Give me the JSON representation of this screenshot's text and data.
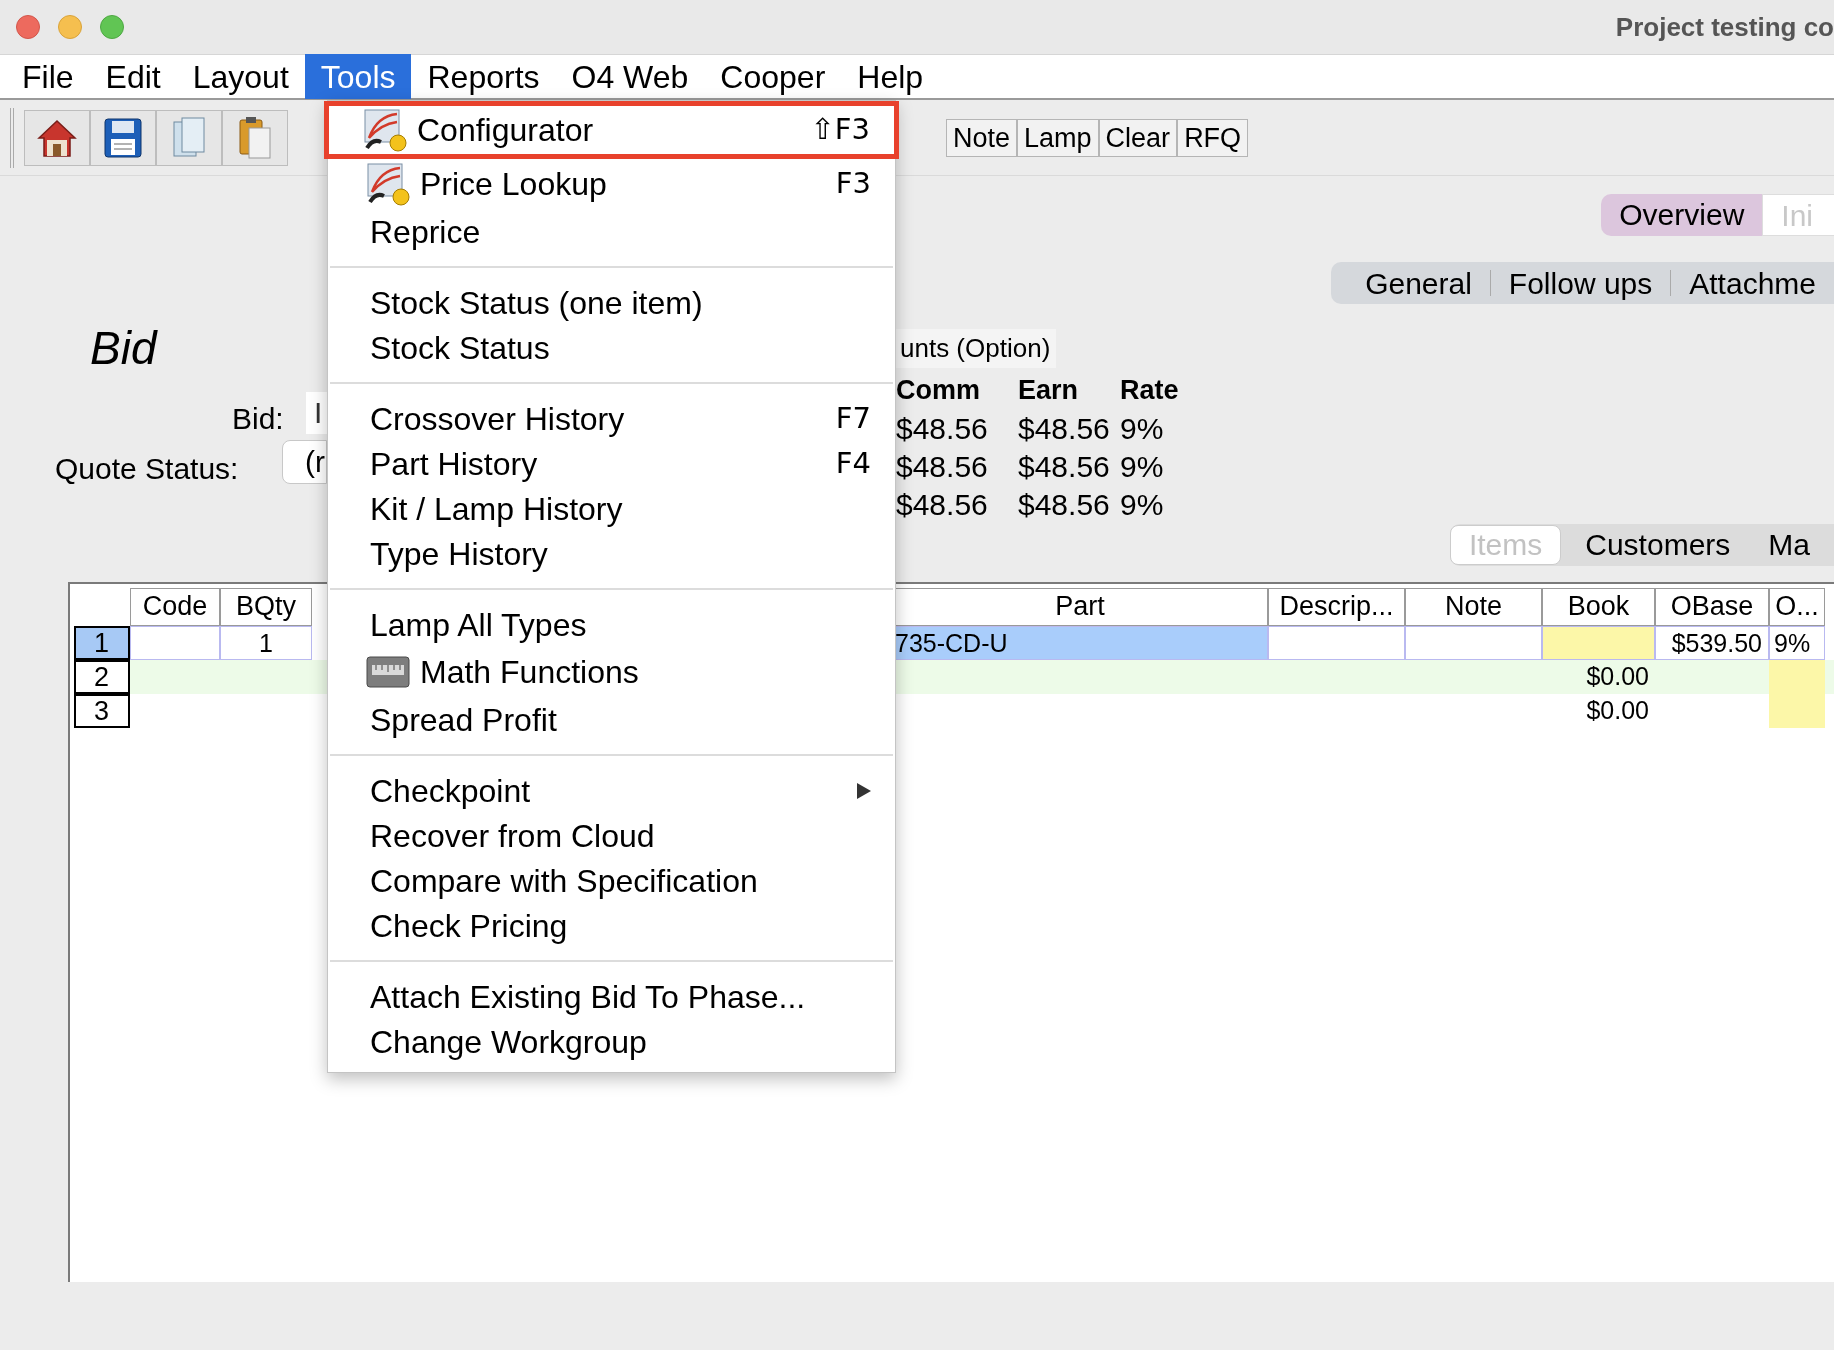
{
  "window": {
    "title": "Project testing co"
  },
  "menu_bar": [
    {
      "label": "File",
      "selected": false
    },
    {
      "label": "Edit",
      "selected": false
    },
    {
      "label": "Layout",
      "selected": false
    },
    {
      "label": "Tools",
      "selected": true
    },
    {
      "label": "Reports",
      "selected": false
    },
    {
      "label": "O4 Web",
      "selected": false
    },
    {
      "label": "Cooper",
      "selected": false
    },
    {
      "label": "Help",
      "selected": false
    }
  ],
  "toolbar": {
    "buttons": [
      "Note",
      "Lamp",
      "Clear",
      "RFQ"
    ]
  },
  "top_tabs": [
    {
      "label": "Overview",
      "selected": true
    },
    {
      "label": "Ini",
      "selected": false
    }
  ],
  "section_tabs": [
    "General",
    "Follow ups",
    "Attachme"
  ],
  "bid": {
    "heading": "Bid",
    "bid_label": "Bid:",
    "bid_value": "I",
    "quote_status_label": "Quote Status:",
    "quote_status_value": "(r"
  },
  "pricing": {
    "caption": "unts (Option)",
    "columns": [
      "Comm",
      "Earn",
      "Rate"
    ],
    "rows": [
      [
        "$48.56",
        "$48.56",
        "9%"
      ],
      [
        "$48.56",
        "$48.56",
        "9%"
      ],
      [
        "$48.56",
        "$48.56",
        "9%"
      ]
    ]
  },
  "items_tabs": [
    {
      "label": "Items",
      "selected": true
    },
    {
      "label": "Customers",
      "selected": false
    },
    {
      "label": "Ma",
      "selected": false
    }
  ],
  "table": {
    "columns": [
      "Code",
      "BQty",
      "Part",
      "Descrip...",
      "Note",
      "Book",
      "OBase",
      "O..."
    ],
    "rows": [
      {
        "number": "1",
        "selected": true,
        "color": "#ffffff",
        "cells": [
          {},
          {
            "text": "1"
          },
          {
            "text": "735-CD-U",
            "color": "#a9cdfb"
          },
          {},
          {},
          {
            "color": "#fcf7a8"
          },
          {
            "text": "$539.50"
          },
          {
            "text": "9%"
          }
        ]
      },
      {
        "number": "2",
        "selected": false,
        "color": "#edfbe8",
        "cells": [
          {},
          {},
          {},
          {},
          {},
          {
            "text": "$0.00"
          },
          {},
          {
            "color": "#fcf7a8"
          }
        ]
      },
      {
        "number": "3",
        "selected": false,
        "color": "#ffffff",
        "cells": [
          {},
          {},
          {},
          {},
          {},
          {
            "text": "$0.00"
          },
          {},
          {
            "color": "#fcf7a8"
          }
        ]
      }
    ]
  },
  "tools_menu": {
    "sections": [
      [
        {
          "label": "Configurator",
          "shortcut": "⇧F3",
          "kind": "chart",
          "highlighted": true,
          "submenu": false
        },
        {
          "label": "Price Lookup",
          "shortcut": "F3",
          "kind": "chart",
          "highlighted": false,
          "submenu": false
        },
        {
          "label": "Reprice",
          "highlighted": false,
          "submenu": false
        }
      ],
      [
        {
          "label": "Stock Status (one item)",
          "highlighted": false,
          "submenu": false
        },
        {
          "label": "Stock Status",
          "highlighted": false,
          "submenu": false
        }
      ],
      [
        {
          "label": "Crossover History",
          "shortcut": "F7",
          "highlighted": false,
          "submenu": false
        },
        {
          "label": "Part History",
          "shortcut": "F4",
          "highlighted": false,
          "submenu": false
        },
        {
          "label": "Kit / Lamp History",
          "highlighted": false,
          "submenu": false
        },
        {
          "label": "Type History",
          "highlighted": false,
          "submenu": false
        }
      ],
      [
        {
          "label": "Lamp All Types",
          "highlighted": false,
          "submenu": false
        },
        {
          "label": "Math Functions",
          "kind": "tool",
          "highlighted": false,
          "submenu": false
        },
        {
          "label": "Spread Profit",
          "highlighted": false,
          "submenu": false
        }
      ],
      [
        {
          "label": "Checkpoint",
          "highlighted": false,
          "submenu": true
        },
        {
          "label": "Recover from Cloud",
          "highlighted": false,
          "submenu": false
        },
        {
          "label": "Compare with Specification",
          "highlighted": false,
          "submenu": false
        },
        {
          "label": "Check Pricing",
          "highlighted": false,
          "submenu": false
        }
      ],
      [
        {
          "label": "Attach Existing Bid To Phase...",
          "highlighted": false,
          "submenu": false
        },
        {
          "label": "Change Workgroup",
          "highlighted": false,
          "submenu": false
        }
      ]
    ]
  }
}
